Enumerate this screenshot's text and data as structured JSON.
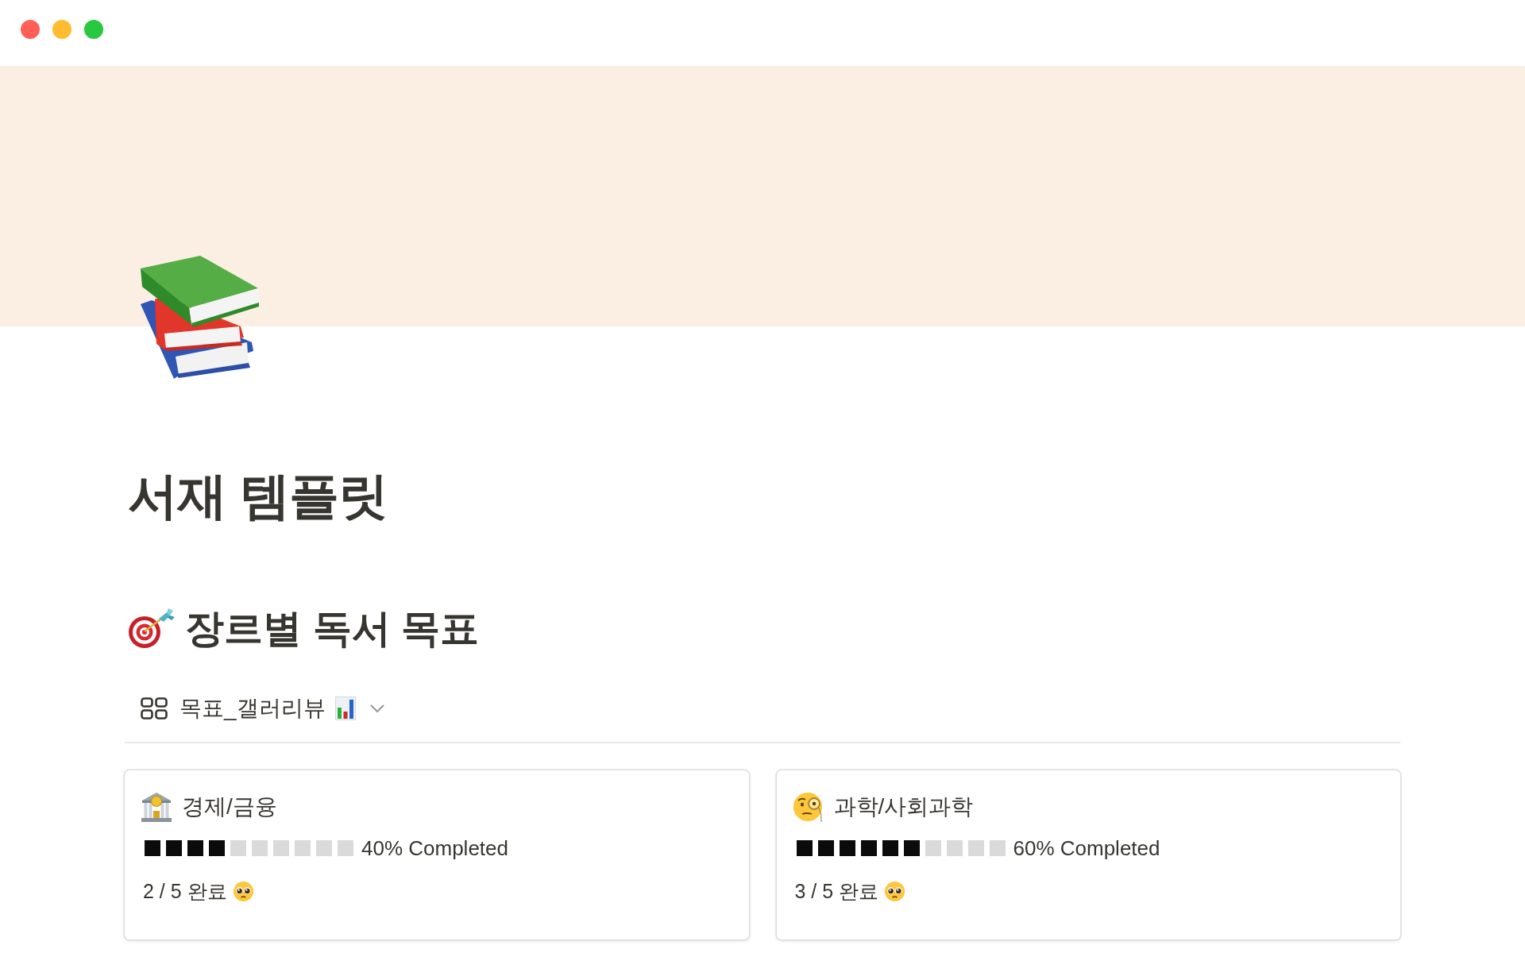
{
  "page": {
    "title": "서재 템플릿"
  },
  "section": {
    "heading": "장르별 독서 목표"
  },
  "view_tab": {
    "label": "목표_갤러리뷰"
  },
  "cards": [
    {
      "title": "경제/금융",
      "level": 0.4,
      "progress_label": "40% Completed",
      "summary": "2 / 5 완료"
    },
    {
      "title": "과학/사회과학",
      "level": 0.6,
      "progress_label": "60% Completed",
      "summary": "3 / 5 완료"
    }
  ]
}
